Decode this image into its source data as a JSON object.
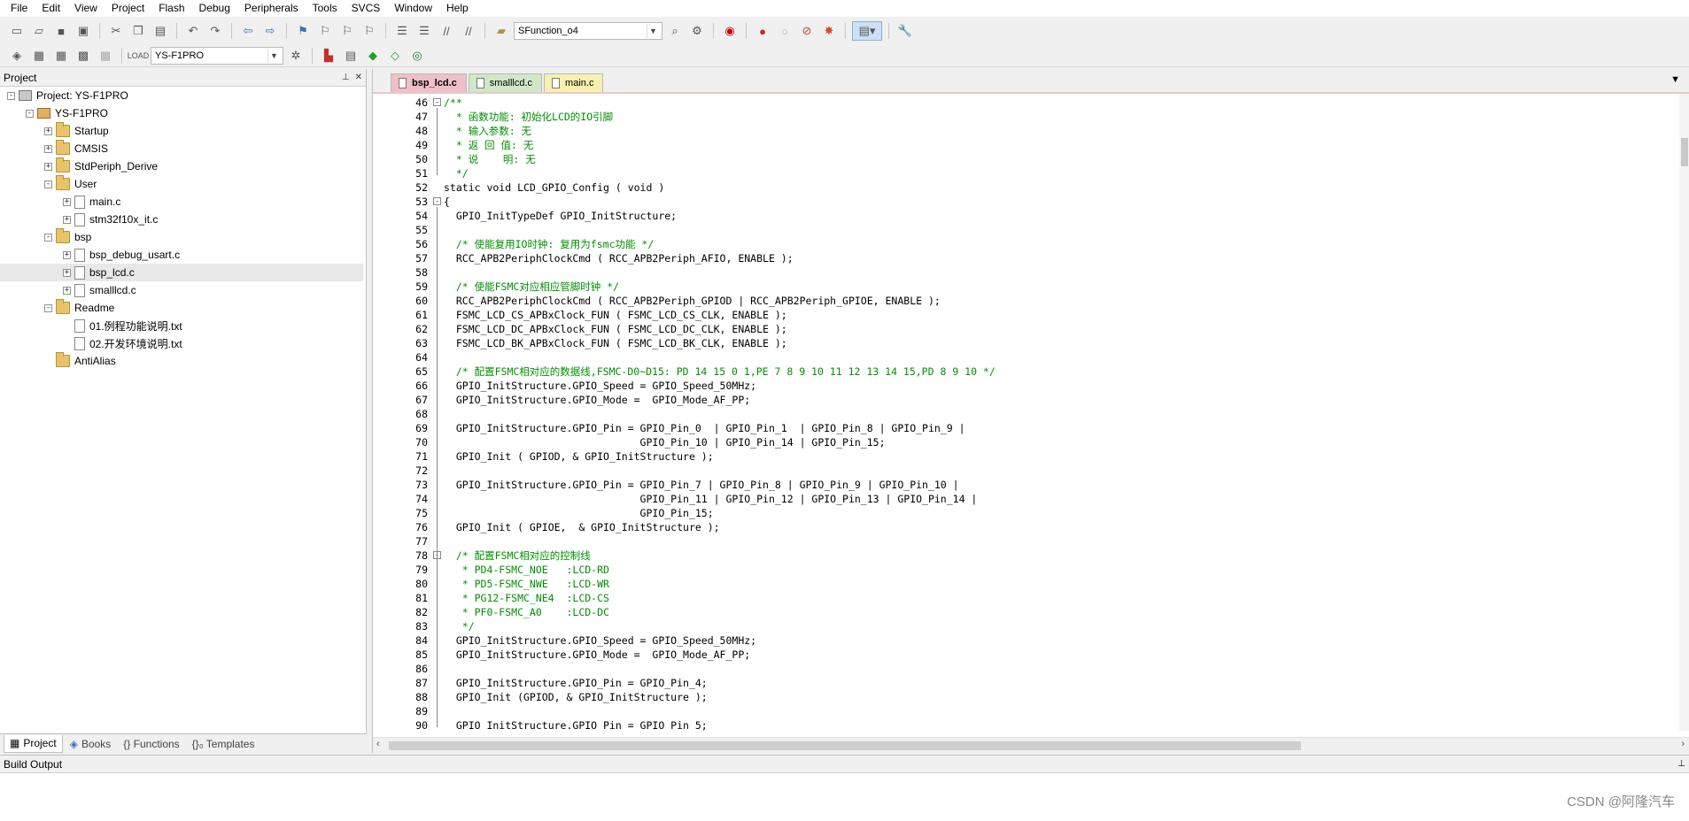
{
  "menu": [
    "File",
    "Edit",
    "View",
    "Project",
    "Flash",
    "Debug",
    "Peripherals",
    "Tools",
    "SVCS",
    "Window",
    "Help"
  ],
  "toolbar": {
    "function_combo": "SFunction_o4",
    "target_combo": "YS-F1PRO"
  },
  "project_pane": {
    "title": "Project",
    "tree": [
      {
        "label": "Project: YS-F1PRO",
        "level": 0,
        "exp": "-",
        "icon": "proj"
      },
      {
        "label": "YS-F1PRO",
        "level": 1,
        "exp": "-",
        "icon": "target"
      },
      {
        "label": "Startup",
        "level": 2,
        "exp": "+",
        "icon": "folder"
      },
      {
        "label": "CMSIS",
        "level": 2,
        "exp": "+",
        "icon": "folder"
      },
      {
        "label": "StdPeriph_Derive",
        "level": 2,
        "exp": "+",
        "icon": "folder"
      },
      {
        "label": "User",
        "level": 2,
        "exp": "-",
        "icon": "folder"
      },
      {
        "label": "main.c",
        "level": 3,
        "exp": "+",
        "icon": "file"
      },
      {
        "label": "stm32f10x_it.c",
        "level": 3,
        "exp": "+",
        "icon": "file"
      },
      {
        "label": "bsp",
        "level": 2,
        "exp": "-",
        "icon": "folder"
      },
      {
        "label": "bsp_debug_usart.c",
        "level": 3,
        "exp": "+",
        "icon": "file"
      },
      {
        "label": "bsp_lcd.c",
        "level": 3,
        "exp": "+",
        "icon": "file",
        "selected": true
      },
      {
        "label": "smalllcd.c",
        "level": 3,
        "exp": "+",
        "icon": "file"
      },
      {
        "label": "Readme",
        "level": 2,
        "exp": "-",
        "icon": "folder"
      },
      {
        "label": "01.例程功能说明.txt",
        "level": 3,
        "exp": "",
        "icon": "file"
      },
      {
        "label": "02.开发环境说明.txt",
        "level": 3,
        "exp": "",
        "icon": "file"
      },
      {
        "label": "AntiAlias",
        "level": 2,
        "exp": "",
        "icon": "folder"
      }
    ],
    "bottom_tabs": [
      "Project",
      "Books",
      "{} Functions",
      "{}₀ Templates"
    ]
  },
  "editor": {
    "tabs": [
      {
        "label": "bsp_lcd.c",
        "color": "red"
      },
      {
        "label": "smalllcd.c",
        "color": "green"
      },
      {
        "label": "main.c",
        "color": "yellow"
      }
    ],
    "lines": [
      {
        "n": "46",
        "t": "/**",
        "c": 1,
        "f": "-"
      },
      {
        "n": "47",
        "t": "  * 函数功能: 初始化LCD的IO引脚",
        "c": 1
      },
      {
        "n": "48",
        "t": "  * 输入参数: 无",
        "c": 1
      },
      {
        "n": "49",
        "t": "  * 返 回 值: 无",
        "c": 1
      },
      {
        "n": "50",
        "t": "  * 说    明: 无",
        "c": 1
      },
      {
        "n": "51",
        "t": "  */",
        "c": 1
      },
      {
        "n": "52",
        "t": "static void LCD_GPIO_Config ( void )",
        "c": 0
      },
      {
        "n": "53",
        "t": "{",
        "c": 0,
        "f": "-"
      },
      {
        "n": "54",
        "t": "  GPIO_InitTypeDef GPIO_InitStructure;",
        "c": 0
      },
      {
        "n": "55",
        "t": "",
        "c": 0
      },
      {
        "n": "56",
        "t": "  /* 使能复用IO时钟: 复用为fsmc功能 */",
        "c": 1
      },
      {
        "n": "57",
        "t": "  RCC_APB2PeriphClockCmd ( RCC_APB2Periph_AFIO, ENABLE );",
        "c": 0
      },
      {
        "n": "58",
        "t": "",
        "c": 0
      },
      {
        "n": "59",
        "t": "  /* 使能FSMC对应相应管脚时钟 */",
        "c": 1
      },
      {
        "n": "60",
        "t": "  RCC_APB2PeriphClockCmd ( RCC_APB2Periph_GPIOD | RCC_APB2Periph_GPIOE, ENABLE );",
        "c": 0
      },
      {
        "n": "61",
        "t": "  FSMC_LCD_CS_APBxClock_FUN ( FSMC_LCD_CS_CLK, ENABLE );",
        "c": 0
      },
      {
        "n": "62",
        "t": "  FSMC_LCD_DC_APBxClock_FUN ( FSMC_LCD_DC_CLK, ENABLE );",
        "c": 0
      },
      {
        "n": "63",
        "t": "  FSMC_LCD_BK_APBxClock_FUN ( FSMC_LCD_BK_CLK, ENABLE );",
        "c": 0
      },
      {
        "n": "64",
        "t": "",
        "c": 0
      },
      {
        "n": "65",
        "t": "  /* 配置FSMC相对应的数据线,FSMC-D0~D15: PD 14 15 0 1,PE 7 8 9 10 11 12 13 14 15,PD 8 9 10 */",
        "c": 1
      },
      {
        "n": "66",
        "t": "  GPIO_InitStructure.GPIO_Speed = GPIO_Speed_50MHz;",
        "c": 0
      },
      {
        "n": "67",
        "t": "  GPIO_InitStructure.GPIO_Mode =  GPIO_Mode_AF_PP;",
        "c": 0
      },
      {
        "n": "68",
        "t": "",
        "c": 0
      },
      {
        "n": "69",
        "t": "  GPIO_InitStructure.GPIO_Pin = GPIO_Pin_0  | GPIO_Pin_1  | GPIO_Pin_8 | GPIO_Pin_9 |",
        "c": 0
      },
      {
        "n": "70",
        "t": "                                GPIO_Pin_10 | GPIO_Pin_14 | GPIO_Pin_15;",
        "c": 0
      },
      {
        "n": "71",
        "t": "  GPIO_Init ( GPIOD, & GPIO_InitStructure );",
        "c": 0
      },
      {
        "n": "72",
        "t": "",
        "c": 0
      },
      {
        "n": "73",
        "t": "  GPIO_InitStructure.GPIO_Pin = GPIO_Pin_7 | GPIO_Pin_8 | GPIO_Pin_9 | GPIO_Pin_10 |",
        "c": 0
      },
      {
        "n": "74",
        "t": "                                GPIO_Pin_11 | GPIO_Pin_12 | GPIO_Pin_13 | GPIO_Pin_14 |",
        "c": 0
      },
      {
        "n": "75",
        "t": "                                GPIO_Pin_15;",
        "c": 0
      },
      {
        "n": "76",
        "t": "  GPIO_Init ( GPIOE,  & GPIO_InitStructure );",
        "c": 0
      },
      {
        "n": "77",
        "t": "",
        "c": 0
      },
      {
        "n": "78",
        "t": "  /* 配置FSMC相对应的控制线",
        "c": 1,
        "f": "-"
      },
      {
        "n": "79",
        "t": "   * PD4-FSMC_NOE   :LCD-RD",
        "c": 1
      },
      {
        "n": "80",
        "t": "   * PD5-FSMC_NWE   :LCD-WR",
        "c": 1
      },
      {
        "n": "81",
        "t": "   * PG12-FSMC_NE4  :LCD-CS",
        "c": 1
      },
      {
        "n": "82",
        "t": "   * PF0-FSMC_A0    :LCD-DC",
        "c": 1
      },
      {
        "n": "83",
        "t": "   */",
        "c": 1
      },
      {
        "n": "84",
        "t": "  GPIO_InitStructure.GPIO_Speed = GPIO_Speed_50MHz;",
        "c": 0
      },
      {
        "n": "85",
        "t": "  GPIO_InitStructure.GPIO_Mode =  GPIO_Mode_AF_PP;",
        "c": 0
      },
      {
        "n": "86",
        "t": "",
        "c": 0
      },
      {
        "n": "87",
        "t": "  GPIO_InitStructure.GPIO_Pin = GPIO_Pin_4;",
        "c": 0
      },
      {
        "n": "88",
        "t": "  GPIO_Init (GPIOD, & GPIO_InitStructure );",
        "c": 0
      },
      {
        "n": "89",
        "t": "",
        "c": 0
      },
      {
        "n": "90",
        "t": "  GPIO_InitStructure.GPIO_Pin = GPIO_Pin_5;",
        "c": 0
      }
    ]
  },
  "build_output": {
    "title": "Build Output"
  },
  "watermark": "CSDN @阿隆汽车",
  "colors": {
    "comment": "#009000",
    "active_tab": "#f0c0c8"
  }
}
